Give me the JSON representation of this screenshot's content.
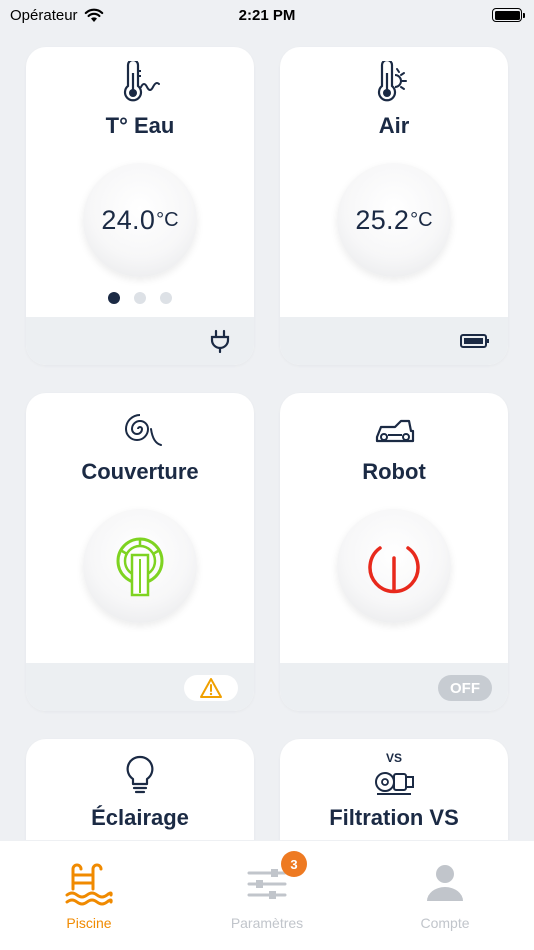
{
  "status_bar": {
    "carrier": "Opérateur",
    "time": "2:21 PM"
  },
  "cards": {
    "water": {
      "title": "T° Eau",
      "value": "24.0",
      "unit": "°C",
      "icon": "thermometer-water-icon",
      "footer_icon": "plug-icon",
      "pager_total": 3,
      "pager_active": 1
    },
    "air": {
      "title": "Air",
      "value": "25.2",
      "unit": "°C",
      "icon": "thermometer-sun-icon",
      "footer_icon": "battery-icon"
    },
    "cover": {
      "title": "Couverture",
      "icon": "cover-roll-icon",
      "state_color": "#7ed321",
      "footer_status": "warning-icon"
    },
    "robot": {
      "title": "Robot",
      "icon": "pool-robot-icon",
      "state_color": "#e8291c",
      "footer_status": "OFF"
    },
    "lighting": {
      "title": "Éclairage",
      "icon": "lightbulb-icon"
    },
    "filtration": {
      "title": "Filtration VS",
      "icon_label": "VS",
      "icon": "pump-icon"
    }
  },
  "tabbar": {
    "items": [
      {
        "label": "Piscine",
        "icon": "pool-ladder-icon",
        "active": true
      },
      {
        "label": "Paramètres",
        "icon": "sliders-icon",
        "badge": "3"
      },
      {
        "label": "Compte",
        "icon": "user-icon"
      }
    ]
  },
  "colors": {
    "accent": "#f08a00",
    "navy": "#1b2a44",
    "on_green": "#7ed321",
    "off_red": "#e8291c",
    "warning": "#f0a000"
  }
}
